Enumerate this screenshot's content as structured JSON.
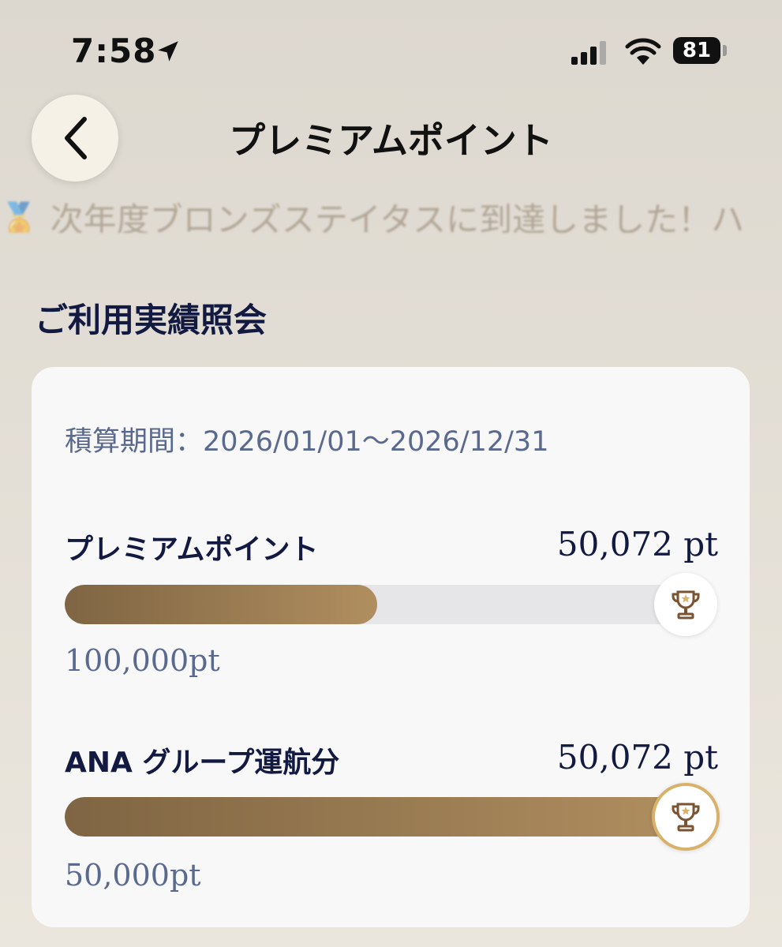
{
  "status_bar": {
    "time": "7:58",
    "battery": "81"
  },
  "header": {
    "title": "プレミアムポイント"
  },
  "notice": {
    "text": "🏅 次年度ブロンズステイタスに到達しました！ハ"
  },
  "section": {
    "title": "ご利用実績照会"
  },
  "card": {
    "period_label": "積算期間：2026/01/01～2026/12/31",
    "rows": [
      {
        "label": "プレミアムポイント",
        "value": "50,072 pt",
        "goal": "100,000pt",
        "progress": 0.5007,
        "achieved": false
      },
      {
        "label": "ANA グループ運航分",
        "value": "50,072 pt",
        "goal": "50,000pt",
        "progress": 1.0,
        "achieved": true
      }
    ]
  },
  "colors": {
    "accent_gold": "#b08e5f",
    "accent_dark_gold": "#7f6543",
    "navy": "#131a42",
    "muted_blue": "#5a6a8e"
  }
}
